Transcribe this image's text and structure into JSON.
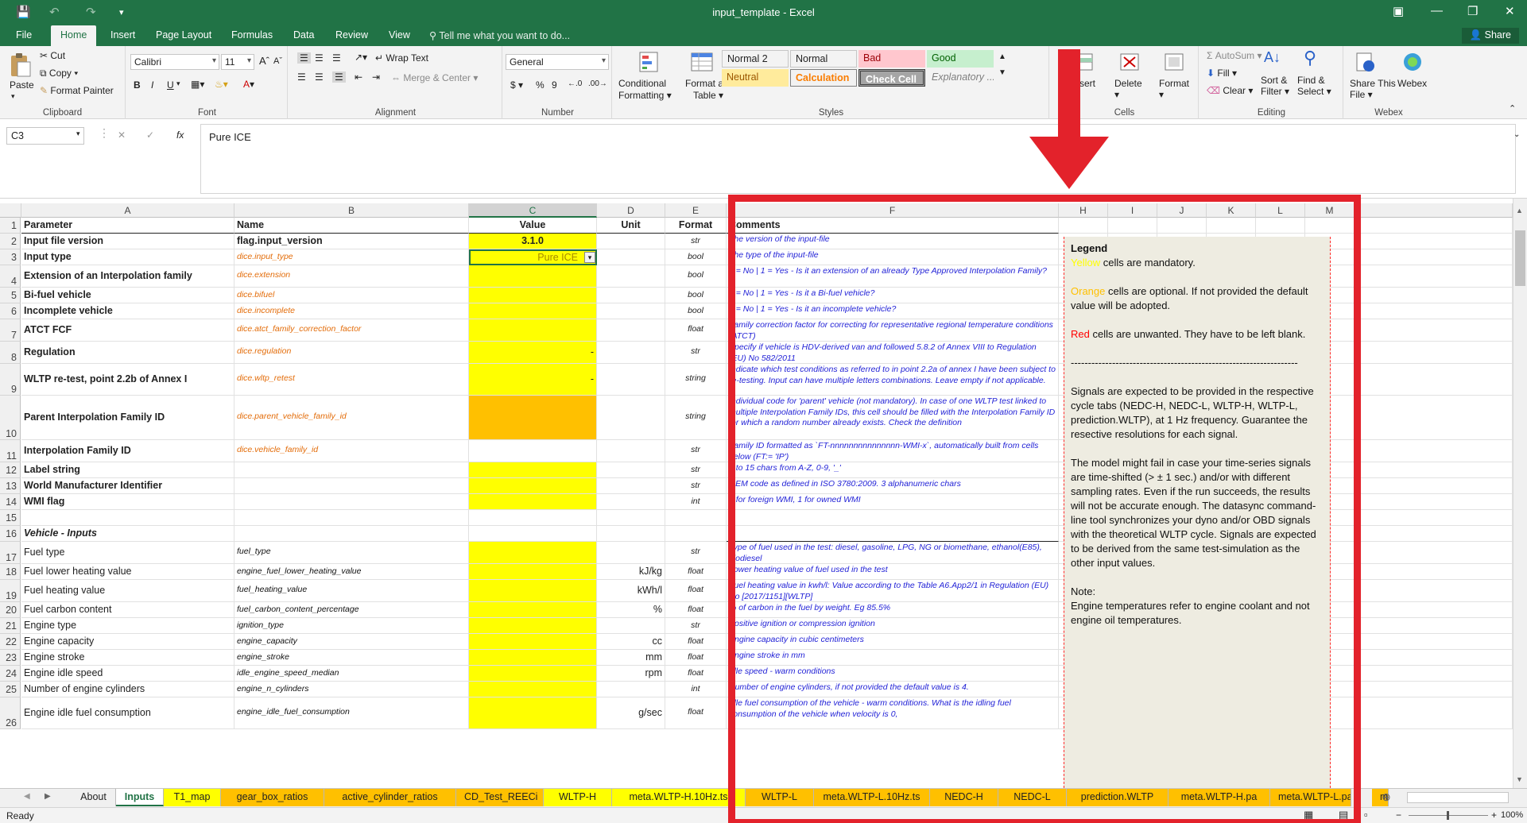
{
  "window": {
    "title": "input_template - Excel",
    "share_label": "Share"
  },
  "ribbon_tabs": [
    "File",
    "Home",
    "Insert",
    "Page Layout",
    "Formulas",
    "Data",
    "Review",
    "View"
  ],
  "tell_me": "Tell me what you want to do...",
  "clipboard": {
    "paste": "Paste",
    "cut": "Cut",
    "copy": "Copy",
    "format_painter": "Format Painter",
    "label": "Clipboard"
  },
  "font": {
    "name": "Calibri",
    "size": "11",
    "bold": "B",
    "italic": "I",
    "underline": "U",
    "label": "Font"
  },
  "alignment": {
    "wrap_text": "Wrap Text",
    "merge_center": "Merge & Center",
    "label": "Alignment"
  },
  "number": {
    "format": "General",
    "currency": "$",
    "percent": "%",
    "comma": "9",
    "label": "Number"
  },
  "styles_group": {
    "conditional": "Conditional",
    "conditional2": "Formatting",
    "format_as": "Format as",
    "format_as2": "Table",
    "cells": [
      {
        "name": "Normal 2",
        "bg": "#ffffff",
        "color": "#222222"
      },
      {
        "name": "Normal",
        "bg": "#ffffff",
        "color": "#222222"
      },
      {
        "name": "Bad",
        "bg": "#ffc7ce",
        "color": "#9c0006"
      },
      {
        "name": "Good",
        "bg": "#c6efce",
        "color": "#006100"
      },
      {
        "name": "Neutral",
        "bg": "#ffeb9c",
        "color": "#9c5700"
      },
      {
        "name": "Calculation",
        "bg": "#f2f2f2",
        "color": "#fa7d00"
      },
      {
        "name": "Check Cell",
        "bg": "#a5a5a5",
        "color": "#ffffff"
      },
      {
        "name": "Explanatory ...",
        "bg": "#ffffff",
        "color": "#7f7f7f"
      }
    ],
    "label": "Styles"
  },
  "cells_group": {
    "insert": "Insert",
    "delete": "Delete",
    "format": "Format",
    "label": "Cells"
  },
  "editing": {
    "autosum": "AutoSum",
    "fill": "Fill",
    "clear": "Clear",
    "sort": "Sort &",
    "sort2": "Filter",
    "find": "Find &",
    "find2": "Select",
    "label": "Editing"
  },
  "webex": {
    "share": "Share This",
    "share2": "File",
    "webex": "Webex",
    "label": "Webex"
  },
  "formula_bar": {
    "name_box": "C3",
    "content": "Pure ICE",
    "cancel": "✕",
    "enter": "✓",
    "fx": "fx"
  },
  "columns": [
    "A",
    "B",
    "C",
    "D",
    "E",
    "F",
    "H",
    "I",
    "J",
    "K",
    "L",
    "M"
  ],
  "rows": [
    {
      "n": "1",
      "a": "Parameter",
      "b": "Name",
      "c": "Value",
      "d": "Unit",
      "e": "Format",
      "f": "Comments"
    },
    {
      "n": "2",
      "a": "Input file version",
      "b": "flag.input_version",
      "c": "3.1.0",
      "d": "",
      "e": "str",
      "f": "The version of the input-file"
    },
    {
      "n": "3",
      "a": "Input type",
      "b": "dice.input_type",
      "c": "Pure ICE",
      "d": "",
      "e": "bool",
      "f": "The type of the input-file"
    },
    {
      "n": "4",
      "a": "Extension of an Interpolation family",
      "b": "dice.extension",
      "c": "",
      "d": "",
      "e": "bool",
      "f": "0 = No | 1 = Yes - Is it an extension of an already Type Approved Interpolation Family?"
    },
    {
      "n": "5",
      "a": "Bi-fuel vehicle",
      "b": "dice.bifuel",
      "c": "",
      "d": "",
      "e": "bool",
      "f": "0 = No | 1 = Yes - Is it a Bi-fuel vehicle?"
    },
    {
      "n": "6",
      "a": "Incomplete vehicle",
      "b": "dice.incomplete",
      "c": "",
      "d": "",
      "e": "bool",
      "f": "0 = No | 1 = Yes - Is it an incomplete vehicle?"
    },
    {
      "n": "7",
      "a": "ATCT FCF",
      "b": "dice.atct_family_correction_factor",
      "c": "",
      "d": "",
      "e": "float",
      "f": "Family correction factor for correcting for representative regional temperature conditions (ATCT)"
    },
    {
      "n": "8",
      "a": "Regulation",
      "b": "dice.regulation",
      "c": "-",
      "d": "",
      "e": "str",
      "f": "Specify if vehicle is HDV-derived van and followed 5.8.2 of Annex VIII to Regulation (EU) No 582/2011"
    },
    {
      "n": "9",
      "a": "WLTP re-test, point 2.2b of Annex I",
      "b": "dice.wltp_retest",
      "c": "-",
      "d": "",
      "e": "string",
      "f": "Indicate which test conditions as referred to in point 2.2a of annex I have been subject to re-testing. Input can have multiple letters combinations. Leave empty if not applicable."
    },
    {
      "n": "10",
      "a": "Parent Interpolation Family ID",
      "b": "dice.parent_vehicle_family_id",
      "c": "",
      "d": "",
      "e": "string",
      "f": "Individual code for 'parent' vehicle (not mandatory). In case of one WLTP test linked to multiple Interpolation Family IDs, this cell should be filled with the  Interpolation Family ID for which a random number already exists. Check the definition"
    },
    {
      "n": "11",
      "a": "Interpolation Family ID",
      "b": "dice.vehicle_family_id",
      "c": "",
      "d": "",
      "e": "str",
      "f": "Family ID formatted as `FT-nnnnnnnnnnnnnnn-WMI-x`, automatically built from cells below (FT:= 'IP')"
    },
    {
      "n": "12",
      "a": "Label string",
      "b": "",
      "c": "",
      "d": "",
      "e": "str",
      "f": "2 to 15 chars from A-Z, 0-9, '_'"
    },
    {
      "n": "13",
      "a": "World Manufacturer Identifier",
      "b": "",
      "c": "",
      "d": "",
      "e": "str",
      "f": "OEM code as defined in ISO 3780:2009. 3 alphanumeric chars"
    },
    {
      "n": "14",
      "a": "WMI flag",
      "b": "",
      "c": "",
      "d": "",
      "e": "int",
      "f": "0 for foreign WMI, 1 for owned WMI"
    },
    {
      "n": "15",
      "a": "",
      "b": "",
      "c": "",
      "d": "",
      "e": "",
      "f": ""
    },
    {
      "n": "16",
      "a": "Vehicle - Inputs",
      "b": "",
      "c": "",
      "d": "",
      "e": "",
      "f": ""
    },
    {
      "n": "17",
      "a": "Fuel type",
      "b": "fuel_type",
      "c": "",
      "d": "",
      "e": "str",
      "f": "Type of fuel used in the test: diesel, gasoline, LPG, NG or biomethane, ethanol(E85), biodiesel"
    },
    {
      "n": "18",
      "a": "Fuel lower heating value",
      "b": "engine_fuel_lower_heating_value",
      "c": "",
      "d": "kJ/kg",
      "e": "float",
      "f": "Lower heating value of fuel used in the test"
    },
    {
      "n": "19",
      "a": "Fuel heating value",
      "b": "fuel_heating_value",
      "c": "",
      "d": "kWh/l",
      "e": "float",
      "f": "Fuel heating value in kwh/l: Value according to the Table A6.App2/1 in Regulation (EU) No [2017/1151][WLTP]"
    },
    {
      "n": "20",
      "a": "Fuel carbon content",
      "b": "fuel_carbon_content_percentage",
      "c": "",
      "d": "%",
      "e": "float",
      "f": "% of carbon in the fuel by weight. Eg 85.5%"
    },
    {
      "n": "21",
      "a": "Engine type",
      "b": "ignition_type",
      "c": "",
      "d": "",
      "e": "str",
      "f": "Positive ignition or compression ignition"
    },
    {
      "n": "22",
      "a": "Engine capacity",
      "b": "engine_capacity",
      "c": "",
      "d": "cc",
      "e": "float",
      "f": "Engine capacity in cubic centimeters"
    },
    {
      "n": "23",
      "a": "Engine stroke",
      "b": "engine_stroke",
      "c": "",
      "d": "mm",
      "e": "float",
      "f": "Engine stroke in mm"
    },
    {
      "n": "24",
      "a": "Engine idle speed",
      "b": "idle_engine_speed_median",
      "c": "",
      "d": "rpm",
      "e": "float",
      "f": "Idle speed - warm conditions"
    },
    {
      "n": "25",
      "a": "Number of engine cylinders",
      "b": "engine_n_cylinders",
      "c": "",
      "d": "",
      "e": "int",
      "f": "Number of engine cylinders, if not provided the default value is 4."
    },
    {
      "n": "26",
      "a": "Engine idle fuel consumption",
      "b": "engine_idle_fuel_consumption",
      "c": "",
      "d": "g/sec",
      "e": "float",
      "f": "Idle fuel consumption of the vehicle - warm conditions. What is the idling fuel consumption of the vehicle when velocity is 0,"
    }
  ],
  "legend": {
    "title": "Legend",
    "yellow_word": "Yellow",
    "yellow_rest": " cells are mandatory.",
    "orange_word": "Orange",
    "orange_rest": " cells are optional. If not provided the default value will be adopted.",
    "red_word": "Red",
    "red_rest": " cells are unwanted. They have to be left blank.",
    "divider": "------------------------------------------------------------------",
    "p_signals": "Signals are expected to be provided in the respective cycle tabs (NEDC-H, NEDC-L, WLTP-H, WLTP-L, prediction.WLTP), at 1 Hz frequency. Guarantee the resective resolutions for each signal.",
    "p_model": "The model might fail in case your time-series signals are time-shifted (> ± 1 sec.) and/or with different sampling rates. Even if the run succeeds, the results will not be accurate enough. The datasync command-line tool synchronizes your dyno and/or OBD signals with the theoretical WLTP cycle. Signals are expected to be derived from the same test-simulation as the other input values.",
    "note": "Note:",
    "p_note": "Engine temperatures refer to engine coolant and not engine oil temperatures."
  },
  "sheet_tabs": [
    {
      "name": "About",
      "style": "plain"
    },
    {
      "name": "Inputs",
      "style": "active"
    },
    {
      "name": "T1_map",
      "style": "y"
    },
    {
      "name": "gear_box_ratios",
      "style": "o"
    },
    {
      "name": "active_cylinder_ratios",
      "style": "o"
    },
    {
      "name": "CD_Test_REECi",
      "style": "o"
    },
    {
      "name": "WLTP-H",
      "style": "y"
    },
    {
      "name": "meta.WLTP-H.10Hz.ts",
      "style": "y"
    },
    {
      "name": "WLTP-L",
      "style": "o"
    },
    {
      "name": "meta.WLTP-L.10Hz.ts",
      "style": "o"
    },
    {
      "name": "NEDC-H",
      "style": "o"
    },
    {
      "name": "NEDC-L",
      "style": "o"
    },
    {
      "name": "prediction.WLTP",
      "style": "o"
    },
    {
      "name": "meta.WLTP-H.pa",
      "style": "o"
    },
    {
      "name": "meta.WLTP-L.pa",
      "style": "o"
    },
    {
      "name": "m",
      "style": "o"
    }
  ],
  "status": {
    "ready": "Ready",
    "zoom": "100%"
  },
  "colors": {
    "excel_green": "#217346",
    "mandatory_yellow": "#ffff00",
    "optional_orange": "#ffc000",
    "annotation_red": "#e3222b",
    "comment_blue": "#1f1fd6"
  }
}
